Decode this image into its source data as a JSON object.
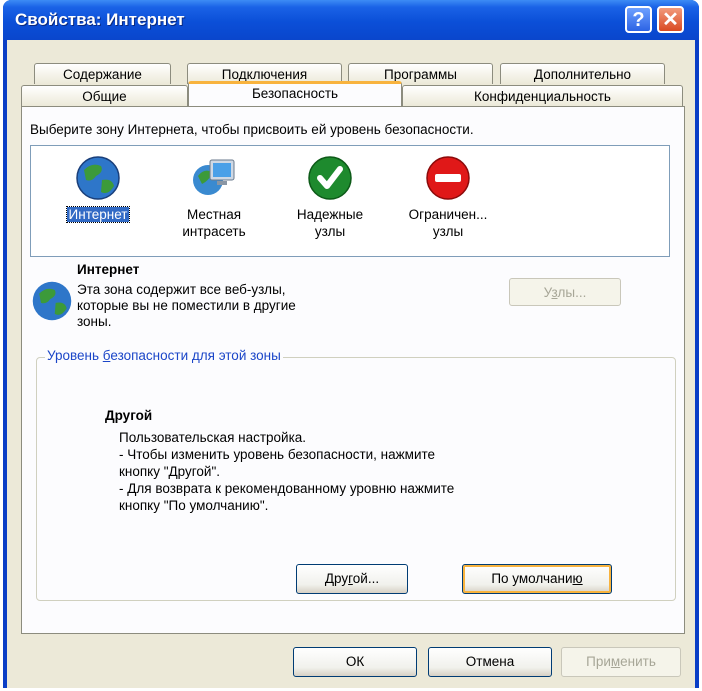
{
  "window": {
    "title": "Свойства: Интернет",
    "help_label": "?",
    "close_label": "✕"
  },
  "tabs_row1": [
    "Содержание",
    "Подключения",
    "Программы",
    "Дополнительно"
  ],
  "tabs_row2": [
    "Общие",
    "Безопасность",
    "Конфиденциальность"
  ],
  "active_tab": "Безопасность",
  "zones_prompt": "Выберите зону Интернета, чтобы присвоить ей уровень безопасности.",
  "zones": [
    {
      "line1": "Интернет",
      "line2": "",
      "icon": "globe-icon",
      "selected": true
    },
    {
      "line1": "Местная",
      "line2": "интрасеть",
      "icon": "intranet-monitor-icon",
      "selected": false
    },
    {
      "line1": "Надежные",
      "line2": "узлы",
      "icon": "checkmark-icon",
      "selected": false
    },
    {
      "line1": "Ограничен...",
      "line2": "узлы",
      "icon": "no-entry-icon",
      "selected": false
    }
  ],
  "zone_info": {
    "name": "Интернет",
    "desc1": "Эта зона содержит все веб-узлы,",
    "desc2": "которые вы не поместили в другие",
    "desc3": "зоны."
  },
  "sites_button": {
    "pre": "У",
    "underline": "з",
    "post": "лы..."
  },
  "group": {
    "label_pre": "Уровень ",
    "label_u": "б",
    "label_post": "езопасности для этой зоны",
    "level_name": "Другой",
    "lines": [
      "Пользовательская настройка.",
      "- Чтобы изменить уровень безопасности, нажмите",
      "кнопку \"Другой\".",
      "- Для возврата к рекомендованному уровню нажмите",
      "кнопку \"По умолчанию\"."
    ]
  },
  "custom_button": {
    "pre": "Дру",
    "underline": "г",
    "post": "ой..."
  },
  "default_button": {
    "pre": "По умолчани",
    "underline": "ю",
    "post": ""
  },
  "footer": {
    "ok": "ОК",
    "cancel": "Отмена",
    "apply_pre": "При",
    "apply_u": "м",
    "apply_post": "енить"
  }
}
